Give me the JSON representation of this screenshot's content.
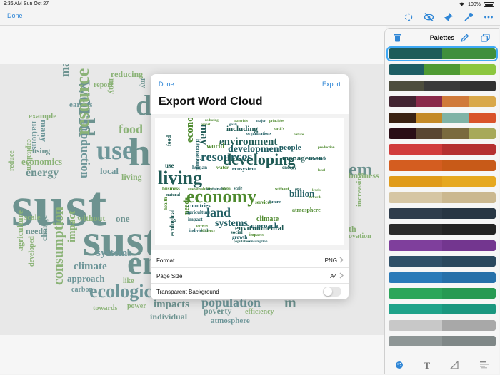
{
  "status": {
    "time": "9:36 AM",
    "date": "Sun Oct 27",
    "battery": "100%"
  },
  "toolbar": {
    "done_label": "Done"
  },
  "background_words": [
    {
      "w": "reducing",
      "c": "g"
    },
    {
      "w": "report",
      "c": "g"
    },
    {
      "w": "may",
      "c": "g"
    },
    {
      "w": "earth's",
      "c": "t1"
    },
    {
      "w": "world",
      "c": "d1"
    },
    {
      "w": "production",
      "c": "t1"
    },
    {
      "w": "food",
      "c": "g"
    },
    {
      "w": "de",
      "c": "d1"
    },
    {
      "w": "use",
      "c": "t1"
    },
    {
      "w": "h",
      "c": "d1"
    },
    {
      "w": "management",
      "c": "d1"
    },
    {
      "w": "resource",
      "c": "g"
    },
    {
      "w": "example",
      "c": "g"
    },
    {
      "w": "nations",
      "c": "t1"
    },
    {
      "w": "many",
      "c": "t1"
    },
    {
      "w": "capitalism",
      "c": "g"
    },
    {
      "w": "using",
      "c": "d1"
    },
    {
      "w": "economics",
      "c": "g"
    },
    {
      "w": "reduce",
      "c": "g"
    },
    {
      "w": "energy",
      "c": "d1"
    },
    {
      "w": "local",
      "c": "t1"
    },
    {
      "w": "living",
      "c": "g"
    },
    {
      "w": "sust",
      "c": "d1"
    },
    {
      "w": "scale",
      "c": "g"
    },
    {
      "w": "without",
      "c": "g"
    },
    {
      "w": "one",
      "c": "d1"
    },
    {
      "w": "needs",
      "c": "d1"
    },
    {
      "w": "sust",
      "c": "d1"
    },
    {
      "w": "agriculture",
      "c": "g"
    },
    {
      "w": "change",
      "c": "d1"
    },
    {
      "w": "impact",
      "c": "g"
    },
    {
      "w": "systems",
      "c": "t1"
    },
    {
      "w": "developed",
      "c": "g"
    },
    {
      "w": "climate",
      "c": "t1"
    },
    {
      "w": "env",
      "c": "d1"
    },
    {
      "w": "approach",
      "c": "t1"
    },
    {
      "w": "consumption",
      "c": "g"
    },
    {
      "w": "like",
      "c": "g"
    },
    {
      "w": "carbon",
      "c": "t1"
    },
    {
      "w": "ecological",
      "c": "t1"
    },
    {
      "w": "towards",
      "c": "g"
    },
    {
      "w": "power",
      "c": "g"
    },
    {
      "w": "impacts",
      "c": "d1"
    },
    {
      "w": "individual",
      "c": "d1"
    },
    {
      "w": "population",
      "c": "t1"
    },
    {
      "w": "poverty",
      "c": "d1"
    },
    {
      "w": "efficiency",
      "c": "g"
    },
    {
      "w": "atmosphere",
      "c": "t1"
    },
    {
      "w": "industrial",
      "c": "g"
    },
    {
      "w": "em",
      "c": "d1"
    },
    {
      "w": "business",
      "c": "g"
    },
    {
      "w": "increasing",
      "c": "g"
    },
    {
      "w": "th",
      "c": "g"
    },
    {
      "w": "ovation",
      "c": "g"
    },
    {
      "w": "my",
      "c": "d1"
    },
    {
      "w": "m",
      "c": "d1"
    }
  ],
  "dialog": {
    "done_label": "Done",
    "export_label": "Export",
    "title": "Export Word Cloud",
    "rows": [
      {
        "label": "Format",
        "value": "PNG"
      },
      {
        "label": "Page Size",
        "value": "A4"
      },
      {
        "label": "Transparent Background",
        "value": ""
      }
    ],
    "transparent_background": false
  },
  "preview_words": [
    "reducing",
    "materials",
    "major",
    "principles",
    "report",
    "goals",
    "including",
    "organizations",
    "earth's",
    "may",
    "environment",
    "nature",
    "international",
    "world",
    "development",
    "people",
    "production",
    "food",
    "economic",
    "resources",
    "developing",
    "management",
    "resource",
    "use",
    "human",
    "water",
    "ecosystem",
    "energy",
    "local",
    "living",
    "economy",
    "billion",
    "business",
    "sustainability",
    "sustainable",
    "global",
    "scale",
    "without",
    "one",
    "levels",
    "natural",
    "services",
    "future",
    "health",
    "needs",
    "countries",
    "land",
    "agriculture",
    "impact",
    "systems",
    "environmental",
    "climate",
    "approach",
    "ecological",
    "social",
    "growth",
    "population",
    "consumption",
    "impacts",
    "poverty",
    "individual",
    "atmosphere",
    "efficiency",
    "towards",
    "carbon",
    "capacity",
    "power",
    "promote"
  ],
  "palettes": {
    "title": "Palettes",
    "swatches": [
      [
        "#1d5c5a",
        "#3f8f3c"
      ],
      [
        "#1e5e64",
        "#4f9a33",
        "#8cc63f"
      ],
      [
        "#4e4e3e",
        "#3b3b3b",
        "#303030"
      ],
      [
        "#422431",
        "#8a2a4a",
        "#d07a3a",
        "#d9a84a"
      ],
      [
        "#3a2213",
        "#c48a28",
        "#7fb3a6",
        "#d9532a"
      ],
      [
        "#2a0d16",
        "#5a4632",
        "#7a6a3e",
        "#a7a95a"
      ],
      [
        "#d13c3c",
        "#b53030"
      ],
      [
        "#d45d20",
        "#c85a18"
      ],
      [
        "#e09b1a",
        "#e6a820"
      ],
      [
        "#d6c6a4",
        "#cbb890"
      ],
      [
        "#2f3d4c",
        "#283644"
      ],
      [
        "#2b2b2b",
        "#232323"
      ],
      [
        "#7f3f9c",
        "#73368f"
      ],
      [
        "#2f5068",
        "#2a485e"
      ],
      [
        "#2a7ab8",
        "#2670a9"
      ],
      [
        "#2ca65a",
        "#279a52"
      ],
      [
        "#1fa38a",
        "#1a977f"
      ],
      [
        "#c8c8c8",
        "#a8a8a8"
      ],
      [
        "#8e9696",
        "#7f8787"
      ]
    ],
    "selected": 0
  }
}
